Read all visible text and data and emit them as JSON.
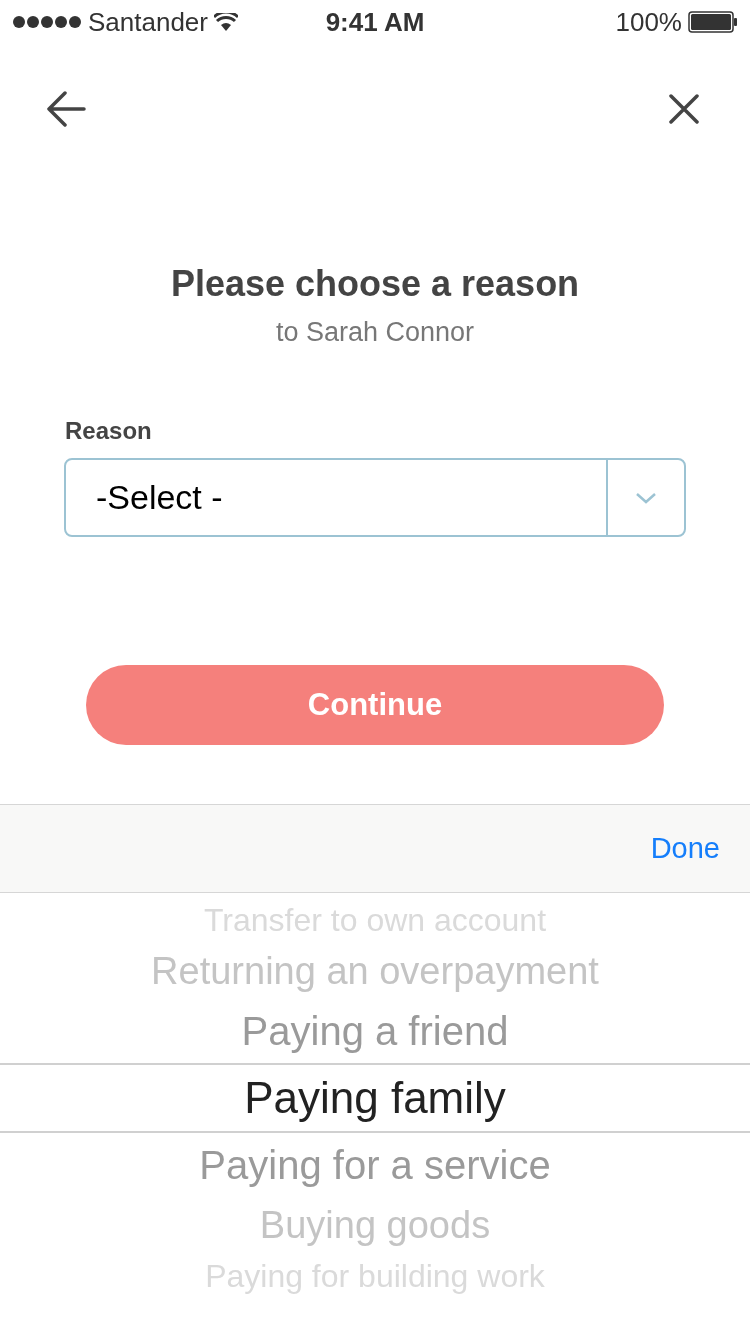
{
  "status_bar": {
    "carrier": "Santander",
    "time": "9:41 AM",
    "battery": "100%"
  },
  "title": "Please choose a reason",
  "subtitle": "to Sarah Connor",
  "reason_field": {
    "label": "Reason",
    "value": "-Select -"
  },
  "continue_button": {
    "label": "Continue",
    "disabled": true
  },
  "picker_toolbar": {
    "done": "Done"
  },
  "picker": [
    {
      "label": "Transfer to own account",
      "selected": false
    },
    {
      "label": "Returning an overpayment",
      "selected": false
    },
    {
      "label": "Paying a friend",
      "selected": false
    },
    {
      "label": "Paying family",
      "selected": true
    },
    {
      "label": "Paying for a service",
      "selected": false
    },
    {
      "label": "Buying goods",
      "selected": false
    },
    {
      "label": "Paying for building work",
      "selected": false
    }
  ]
}
